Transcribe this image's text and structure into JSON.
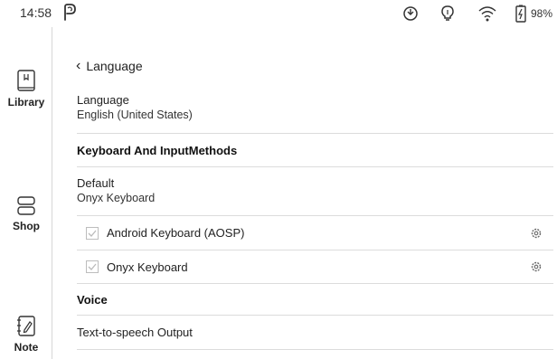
{
  "status_bar": {
    "time": "14:58",
    "app_icon": "p-icon",
    "icons": [
      "sync-icon",
      "lightbulb-icon",
      "wifi-icon",
      "battery-icon"
    ],
    "battery_percent": "98%"
  },
  "sidebar": {
    "items": [
      {
        "label": "Library",
        "icon": "book-icon"
      },
      {
        "label": "Shop",
        "icon": "shop-icon"
      },
      {
        "label": "Note",
        "icon": "pen-icon"
      }
    ]
  },
  "page": {
    "back_label": "Language",
    "language": {
      "title": "Language",
      "value": "English (United States)"
    },
    "keyboard_section": "Keyboard And InputMethods",
    "default": {
      "title": "Default",
      "value": "Onyx Keyboard"
    },
    "keyboards": [
      {
        "label": "Android Keyboard (AOSP)",
        "checked": true
      },
      {
        "label": "Onyx Keyboard",
        "checked": true
      }
    ],
    "voice_section": "Voice",
    "tts_label": "Text-to-speech Output"
  }
}
